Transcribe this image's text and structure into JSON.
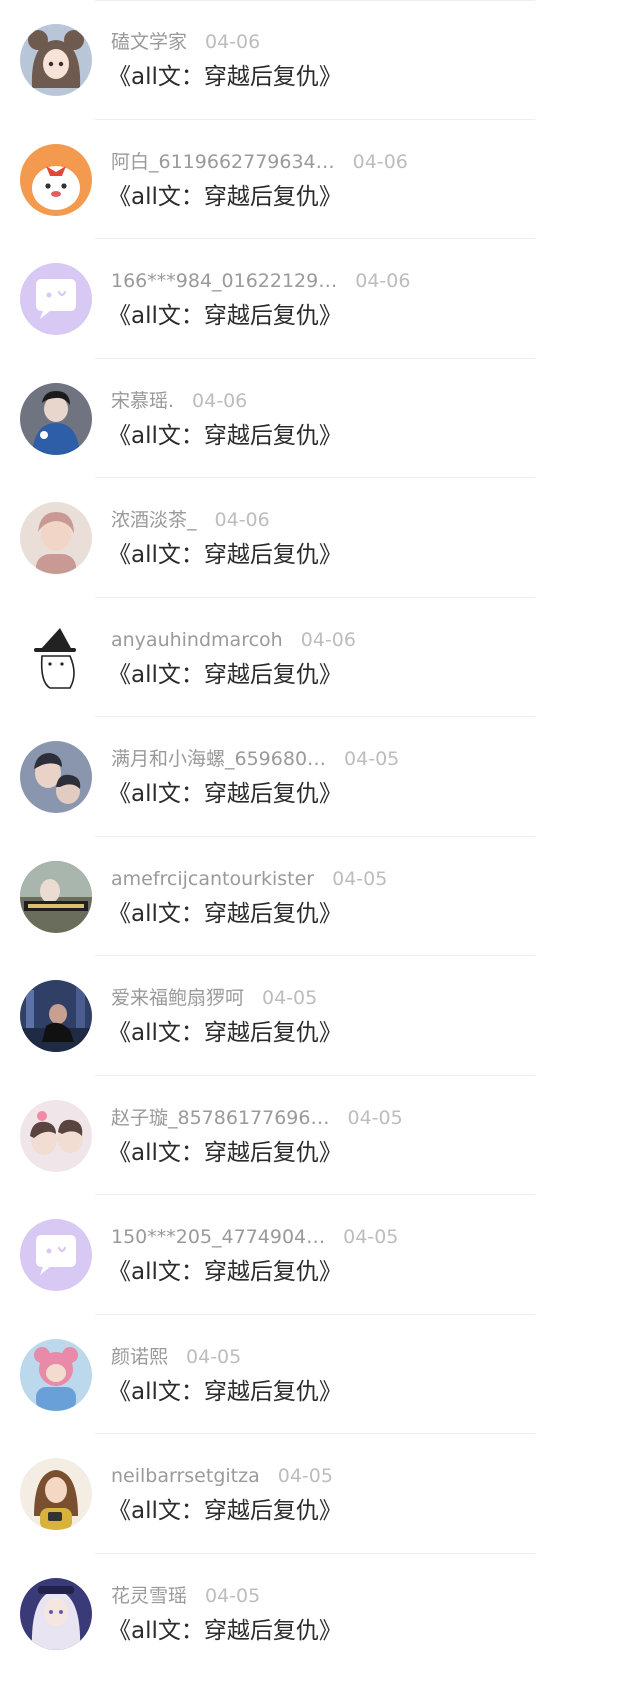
{
  "comments": [
    {
      "name": "磕文学家",
      "time": "04-06",
      "text": "《all文：穿越后复仇》",
      "avatar": "anime-girl-hood",
      "avatar_bg": "#b9c6d8",
      "avatar_fg": "#6f5a50"
    },
    {
      "name": "阿白_6119662779634…",
      "time": "04-06",
      "text": "《all文：穿越后复仇》",
      "avatar": "cartoon-dog",
      "avatar_bg": "#f49a4e",
      "avatar_fg": "#ffffff"
    },
    {
      "name": "166***984_01622129…",
      "time": "04-06",
      "text": "《all文：穿越后复仇》",
      "avatar": "default-chat-bubble",
      "avatar_bg": "#d8c8f4",
      "avatar_fg": "#ffffff"
    },
    {
      "name": "宋慕瑶.",
      "time": "04-06",
      "text": "《all文：穿越后复仇》",
      "avatar": "person-blue-jacket",
      "avatar_bg": "#6f7480",
      "avatar_fg": "#2f5ea8"
    },
    {
      "name": "浓酒淡茶_",
      "time": "04-06",
      "text": "《all文：穿越后复仇》",
      "avatar": "pale-face",
      "avatar_bg": "#eadfd8",
      "avatar_fg": "#c99a93"
    },
    {
      "name": "anyauhindmarcoh",
      "time": "04-06",
      "text": "《all文：穿越后复仇》",
      "avatar": "witch-cat-sketch",
      "avatar_bg": "#ffffff",
      "avatar_fg": "#222222"
    },
    {
      "name": "满月和小海螺_659680…",
      "time": "04-05",
      "text": "《all文：穿越后复仇》",
      "avatar": "couple-photo",
      "avatar_bg": "#8a96ad",
      "avatar_fg": "#2c2f3a"
    },
    {
      "name": "amefrcijcantourkister",
      "time": "04-05",
      "text": "《all文：穿越后复仇》",
      "avatar": "photo-with-caption",
      "avatar_bg": "#6a6c5c",
      "avatar_fg": "#d8c070"
    },
    {
      "name": "爱来福鲍扇猡呵",
      "time": "04-05",
      "text": "《all文：穿越后复仇》",
      "avatar": "night-city-person",
      "avatar_bg": "#2f3f66",
      "avatar_fg": "#c8a090"
    },
    {
      "name": "赵子璇_85786177696…",
      "time": "04-05",
      "text": "《all文：穿越后复仇》",
      "avatar": "two-boys-sticker",
      "avatar_bg": "#f0e6ea",
      "avatar_fg": "#5a4440"
    },
    {
      "name": "150***205_4774904…",
      "time": "04-05",
      "text": "《all文：穿越后复仇》",
      "avatar": "default-chat-bubble",
      "avatar_bg": "#d8c8f4",
      "avatar_fg": "#ffffff"
    },
    {
      "name": "颜诺熙",
      "time": "04-05",
      "text": "《all文：穿越后复仇》",
      "avatar": "child-pink-bear",
      "avatar_bg": "#bcd8ec",
      "avatar_fg": "#e88aa8"
    },
    {
      "name": "neilbarrsetgitza",
      "time": "04-05",
      "text": "《all文：穿越后复仇》",
      "avatar": "illustrated-girl-camera",
      "avatar_bg": "#f4ede4",
      "avatar_fg": "#7a4f30"
    },
    {
      "name": "花灵雪瑶",
      "time": "04-05",
      "text": "《all文：穿越后复仇》",
      "avatar": "anime-girl-silver-hair",
      "avatar_bg": "#3b3a78",
      "avatar_fg": "#e8e4f2"
    }
  ]
}
